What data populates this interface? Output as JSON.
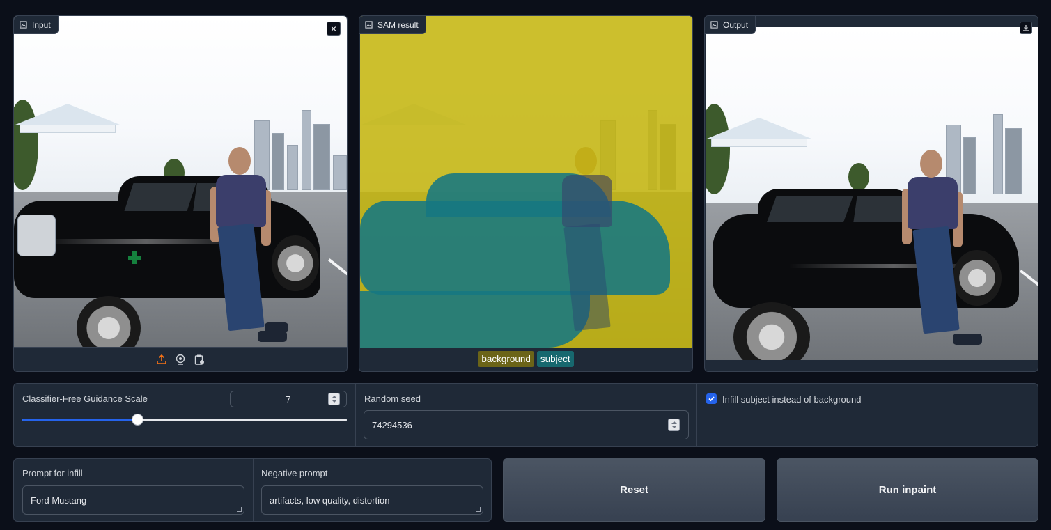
{
  "panels": {
    "input": {
      "label": "Input"
    },
    "sam": {
      "label": "SAM result",
      "legend": [
        {
          "label": "background",
          "color": "#6b6418"
        },
        {
          "label": "subject",
          "color": "#17686f"
        }
      ]
    },
    "output": {
      "label": "Output"
    }
  },
  "controls": {
    "cfg": {
      "label": "Classifier-Free Guidance Scale",
      "value": "7",
      "slider_fraction": 0.355
    },
    "seed": {
      "label": "Random seed",
      "value": "74294536"
    },
    "infill_subject": {
      "label": "Infill subject instead of background",
      "checked": true
    }
  },
  "prompts": {
    "prompt": {
      "label": "Prompt for infill",
      "value": "Ford Mustang"
    },
    "negative": {
      "label": "Negative prompt",
      "value": "artifacts, low quality, distortion"
    }
  },
  "buttons": {
    "reset": "Reset",
    "run": "Run inpaint"
  },
  "colors": {
    "accent": "#2563eb",
    "background": "#0b0f19",
    "panel": "#1f2937",
    "click_marker": "#15803d"
  },
  "icons": [
    "image-icon",
    "close-icon",
    "upload-icon",
    "webcam-icon",
    "clipboard-icon",
    "download-icon",
    "add-point-icon"
  ]
}
